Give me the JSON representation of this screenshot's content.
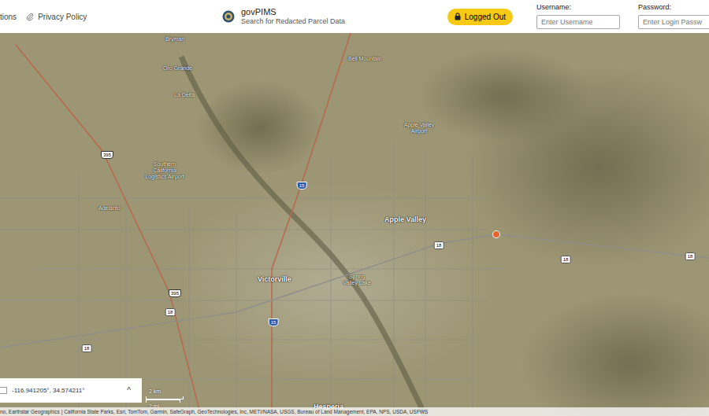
{
  "header": {
    "nav": [
      {
        "label": "tions"
      },
      {
        "label": "Privacy Policy"
      }
    ],
    "app": {
      "title": "govPIMS",
      "subtitle": "Search for Redacted Parcel Data"
    },
    "status": "Logged Out",
    "login": {
      "username_label": "Username:",
      "username_placeholder": "Enter Username",
      "password_label": "Password:",
      "password_placeholder": "Enter Login Passw"
    }
  },
  "map": {
    "places": [
      {
        "label": "Bryman",
        "kind": "feature"
      },
      {
        "label": "Oro Grande",
        "kind": "feature"
      },
      {
        "label": "La Delta",
        "kind": "feature"
      },
      {
        "label": "Southern California Logistics Airport",
        "kind": "feature"
      },
      {
        "label": "Adelanto",
        "kind": "feature"
      },
      {
        "label": "Bell Mountain",
        "kind": "feature"
      },
      {
        "label": "Apple Valley Airport",
        "kind": "feature"
      },
      {
        "label": "Apple Valley",
        "kind": "town"
      },
      {
        "label": "Victorville",
        "kind": "town"
      },
      {
        "label": "Spring Valley Lake",
        "kind": "feature"
      },
      {
        "label": "Hesperia",
        "kind": "town"
      }
    ],
    "shields": [
      {
        "label": "395",
        "kind": "us"
      },
      {
        "label": "395",
        "kind": "us"
      },
      {
        "label": "15",
        "kind": "interstate"
      },
      {
        "label": "15",
        "kind": "interstate"
      },
      {
        "label": "18",
        "kind": "state"
      },
      {
        "label": "18",
        "kind": "state"
      },
      {
        "label": "18",
        "kind": "state"
      },
      {
        "label": "18",
        "kind": "state"
      },
      {
        "label": "18",
        "kind": "state"
      }
    ],
    "pins": [
      {
        "color": "#e8632b"
      }
    ],
    "coordinates": "-116.941205°, 34.574211°",
    "expand": "^",
    "scale": {
      "metric": "2 km",
      "imperial": "2 mi"
    },
    "attribution": "no, Earthstar Geographics | California State Parks, Esri, TomTom, Garmin, SafeGraph, GeoTechnologies, Inc, METI/NASA, USGS, Bureau of Land Management, EPA, NPS, USDA, USFWS"
  }
}
